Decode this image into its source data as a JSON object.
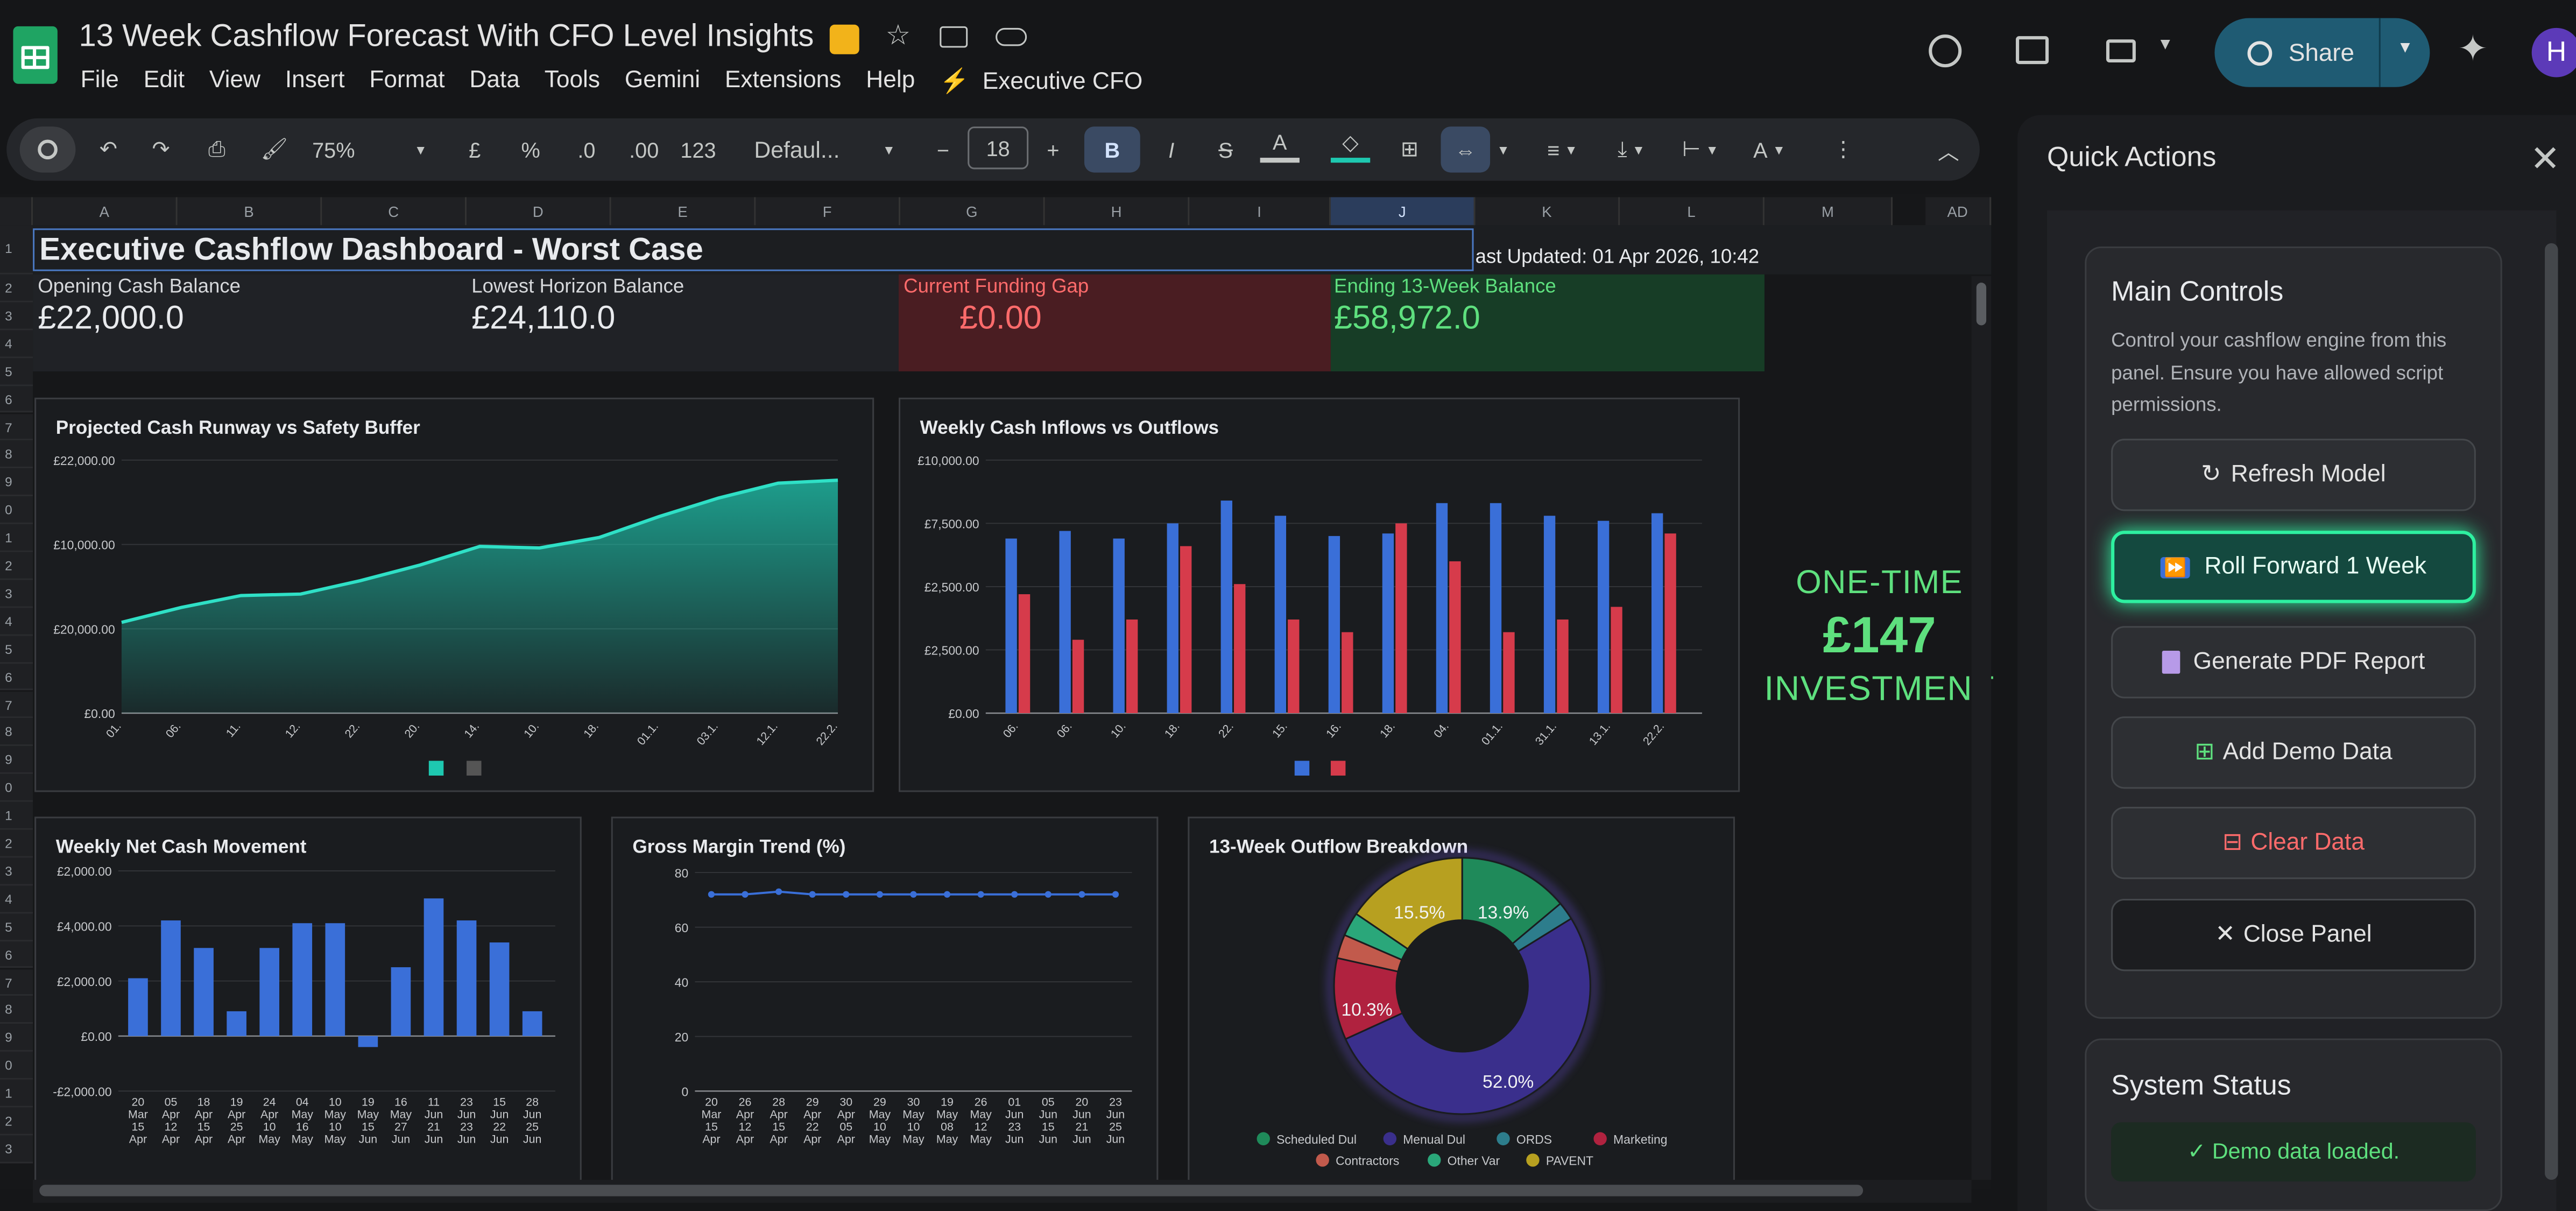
{
  "app": {
    "title": "13 Week Cashflow Forecast With CFO Level Insights",
    "menus": [
      "File",
      "Edit",
      "View",
      "Insert",
      "Format",
      "Data",
      "Tools",
      "Gemini",
      "Extensions",
      "Help"
    ],
    "addon_menu": "Executive CFO",
    "share_label": "Share",
    "avatar_initial": "H"
  },
  "toolbar": {
    "zoom": "75%",
    "currency": "£",
    "percent": "%",
    "dec_dec": ".0",
    "dec_inc": ".00",
    "number_format": "123",
    "font": "Defaul...",
    "font_size": "18"
  },
  "columns": [
    "A",
    "B",
    "C",
    "D",
    "E",
    "F",
    "G",
    "H",
    "I",
    "J",
    "K",
    "L",
    "M",
    "AD"
  ],
  "rows": [
    "1",
    "2",
    "3",
    "4",
    "5",
    "6",
    "7",
    "8",
    "9",
    "0",
    "1",
    "2",
    "3",
    "4",
    "5",
    "6",
    "7",
    "8",
    "9",
    "0",
    "1",
    "2",
    "3",
    "4",
    "5",
    "6",
    "7",
    "8",
    "9",
    "0",
    "1",
    "2",
    "3",
    "4",
    "5"
  ],
  "dashboard": {
    "title": "Executive Cashflow Dashboard - Worst Case",
    "last_updated": "ast Updated: 01 Apr 2026, 10:42",
    "kpis": [
      {
        "label": "Opening Cash Balance",
        "value": "£22,000.0"
      },
      {
        "label": "Lowest Horizon Balance",
        "value": "£24,110.0"
      },
      {
        "label": "Current Funding Gap",
        "value": "£0.00"
      },
      {
        "label": "Ending 13-Week Balance",
        "value": "£58,972.0"
      }
    ]
  },
  "promo": {
    "line1": "ONE-TIME",
    "line2": "£147",
    "line3": "INVESTMENT"
  },
  "panel": {
    "title": "Quick Actions",
    "main_title": "Main Controls",
    "main_desc": "Control your cashflow engine from this panel. Ensure you have allowed script permissions.",
    "buttons": {
      "refresh": "Refresh Model",
      "roll": "Roll Forward 1 Week",
      "pdf": "Generate PDF Report",
      "demo": "Add Demo Data",
      "clear": "Clear Data",
      "close": "Close Panel"
    },
    "status_title": "System Status",
    "status_text": "✓ Demo data loaded."
  },
  "chart_data": [
    {
      "type": "area",
      "title": "Projected Cash Runway vs Safety Buffer",
      "y_ticks": [
        "£22,000.00",
        "£10,000.00",
        "£20,000.00",
        "£0.00"
      ],
      "x": [
        "01.",
        "06.",
        "11.",
        "12.",
        "22.",
        "20.",
        "14.",
        "10.",
        "18.",
        "01.1.",
        "03.1.",
        "12.1.",
        "22.2."
      ],
      "values": [
        12200,
        14200,
        15800,
        16000,
        17800,
        19900,
        22400,
        22200,
        23600,
        26400,
        28900,
        30900,
        31300
      ],
      "ylim": [
        0,
        34000
      ],
      "colors": [
        "#1ec8b0",
        "#555555"
      ]
    },
    {
      "type": "bar",
      "title": "Weekly Cash Inflows vs Outflows",
      "y_ticks": [
        "£10,000.00",
        "£7,500.00",
        "£2,500.00",
        "£2,500.00",
        "£0.00"
      ],
      "x": [
        "06.",
        "06.",
        "10.",
        "18.",
        "22.",
        "15.",
        "16.",
        "18.",
        "04.",
        "01.1.",
        "31.1.",
        "13.1.",
        "22.2."
      ],
      "series": [
        {
          "values": [
            6900,
            7200,
            6900,
            7500,
            8400,
            7800,
            7000,
            7100,
            8300,
            8300,
            7800,
            7600,
            7900
          ]
        },
        {
          "values": [
            4700,
            2900,
            3700,
            6600,
            5100,
            3700,
            3200,
            7500,
            6000,
            3200,
            3700,
            4200,
            7100
          ]
        }
      ],
      "ylim": [
        0,
        10000
      ],
      "colors": [
        "#3a6fd8",
        "#d63b4b"
      ]
    },
    {
      "type": "bar",
      "title": "Weekly Net Cash Movement",
      "y_ticks": [
        "£2,000.00",
        "£4,000.00",
        "£2,000.00",
        "£0.00",
        "-£2,000.00"
      ],
      "x": [
        "20 Mar 15 Apr",
        "05 Apr 12 Apr",
        "18 Apr 15 Apr",
        "19 Apr 25 Apr",
        "24 Apr 10 May",
        "04 May 16 May",
        "10 May 10 May",
        "19 May 15 Jun",
        "16 May 27 Jun",
        "11 Jun 21 Jun",
        "23 Jun 23 Jun",
        "15 Jun 22 Jun",
        "28 Jun 25 Jun"
      ],
      "values": [
        2100,
        4200,
        3200,
        900,
        3200,
        4100,
        4100,
        -400,
        2500,
        5000,
        4200,
        3400,
        900
      ],
      "ylim": [
        -2000,
        6000
      ],
      "colors": [
        "#3a6fd8"
      ]
    },
    {
      "type": "line",
      "title": "Gross Margin Trend (%)",
      "y_ticks": [
        "80",
        "60",
        "40",
        "20",
        "0"
      ],
      "x": [
        "20 Mar 15 Apr",
        "26 Apr 12 Apr",
        "28 Apr 15 Apr",
        "29 Apr 22 Apr",
        "30 Apr 05 Apr",
        "29 May 10 May",
        "30 May 10 May",
        "19 May 08 May",
        "26 May 12 May",
        "01 Jun 23 Jun",
        "05 Jun 15 Jun",
        "20 Jun 21 Jun",
        "23 Jun 25 Jun"
      ],
      "values": [
        72,
        72,
        73,
        72,
        72,
        72,
        72,
        72,
        72,
        72,
        72,
        72,
        72
      ],
      "ylim": [
        0,
        80
      ],
      "colors": [
        "#3a6fd8"
      ]
    },
    {
      "type": "pie",
      "title": "13-Week Outflow Breakdown",
      "slices": [
        {
          "label": "Scheduled Dul",
          "value": 13.9,
          "color": "#1f8a5a"
        },
        {
          "label": "ORDS",
          "value": 2.3,
          "color": "#2d7d8c"
        },
        {
          "label": "Menual Dul",
          "value": 52.0,
          "color": "#3a2f8c"
        },
        {
          "label": "Marketing",
          "value": 10.3,
          "color": "#b0223f"
        },
        {
          "label": "Contractors",
          "value": 3.0,
          "color": "#c25a4c"
        },
        {
          "label": "Other Var",
          "value": 3.0,
          "color": "#2aa77a"
        },
        {
          "label": "PAVENT",
          "value": 15.5,
          "color": "#b7a020"
        }
      ],
      "slice_labels": [
        "13.9%",
        "52.0%",
        "10.3%",
        "15.5%"
      ],
      "legend": [
        "Scheduled Dul",
        "Menual Dul",
        "ORDS",
        "Marketing",
        "Contractors",
        "Other Var",
        "PAVENT"
      ]
    }
  ]
}
